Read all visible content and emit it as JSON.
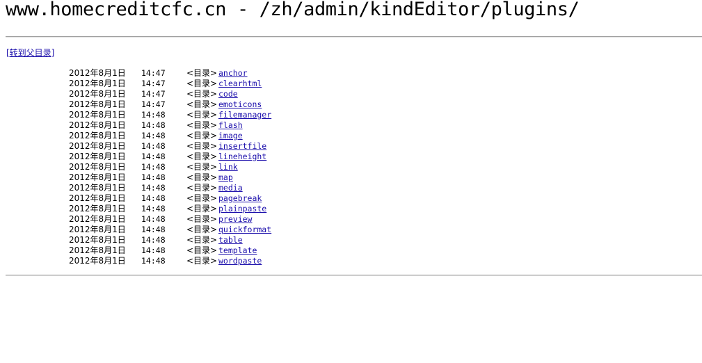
{
  "heading": "www.homecreditcfc.cn - /zh/admin/kindEditor/plugins/",
  "parent_link": "[转到父目录]",
  "colors": {
    "link": "#1a0dab",
    "rule": "#a0a0a0"
  },
  "entries": [
    {
      "date": "2012年8月1日",
      "time": "14:47",
      "type": "<目录>",
      "name": "anchor"
    },
    {
      "date": "2012年8月1日",
      "time": "14:47",
      "type": "<目录>",
      "name": "clearhtml"
    },
    {
      "date": "2012年8月1日",
      "time": "14:47",
      "type": "<目录>",
      "name": "code"
    },
    {
      "date": "2012年8月1日",
      "time": "14:47",
      "type": "<目录>",
      "name": "emoticons"
    },
    {
      "date": "2012年8月1日",
      "time": "14:48",
      "type": "<目录>",
      "name": "filemanager"
    },
    {
      "date": "2012年8月1日",
      "time": "14:48",
      "type": "<目录>",
      "name": "flash"
    },
    {
      "date": "2012年8月1日",
      "time": "14:48",
      "type": "<目录>",
      "name": "image"
    },
    {
      "date": "2012年8月1日",
      "time": "14:48",
      "type": "<目录>",
      "name": "insertfile"
    },
    {
      "date": "2012年8月1日",
      "time": "14:48",
      "type": "<目录>",
      "name": "lineheight"
    },
    {
      "date": "2012年8月1日",
      "time": "14:48",
      "type": "<目录>",
      "name": "link"
    },
    {
      "date": "2012年8月1日",
      "time": "14:48",
      "type": "<目录>",
      "name": "map"
    },
    {
      "date": "2012年8月1日",
      "time": "14:48",
      "type": "<目录>",
      "name": "media"
    },
    {
      "date": "2012年8月1日",
      "time": "14:48",
      "type": "<目录>",
      "name": "pagebreak"
    },
    {
      "date": "2012年8月1日",
      "time": "14:48",
      "type": "<目录>",
      "name": "plainpaste"
    },
    {
      "date": "2012年8月1日",
      "time": "14:48",
      "type": "<目录>",
      "name": "preview"
    },
    {
      "date": "2012年8月1日",
      "time": "14:48",
      "type": "<目录>",
      "name": "quickformat"
    },
    {
      "date": "2012年8月1日",
      "time": "14:48",
      "type": "<目录>",
      "name": "table"
    },
    {
      "date": "2012年8月1日",
      "time": "14:48",
      "type": "<目录>",
      "name": "template"
    },
    {
      "date": "2012年8月1日",
      "time": "14:48",
      "type": "<目录>",
      "name": "wordpaste"
    }
  ]
}
